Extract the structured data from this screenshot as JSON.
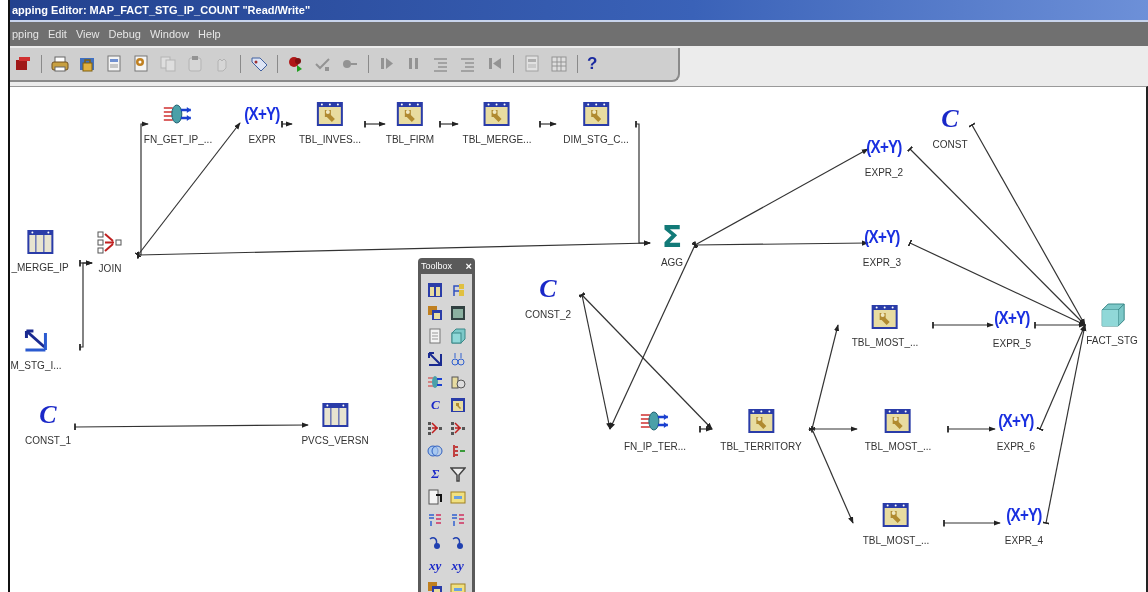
{
  "window": {
    "title": "apping Editor: MAP_FACT_STG_IP_COUNT \"Read/Write\""
  },
  "menu": [
    {
      "label": "pping"
    },
    {
      "label": "Edit"
    },
    {
      "label": "View"
    },
    {
      "label": "Debug"
    },
    {
      "label": "Window"
    },
    {
      "label": "Help"
    }
  ],
  "toolbar": [
    {
      "kind": "red-cube",
      "disabled": false
    },
    {
      "kind": "separator"
    },
    {
      "kind": "print",
      "disabled": false
    },
    {
      "kind": "lock",
      "disabled": false
    },
    {
      "kind": "document",
      "disabled": false
    },
    {
      "kind": "settings-doc",
      "disabled": false
    },
    {
      "kind": "copy",
      "disabled": true
    },
    {
      "kind": "paste",
      "disabled": true
    },
    {
      "kind": "undo",
      "disabled": true
    },
    {
      "kind": "separator"
    },
    {
      "kind": "tag",
      "disabled": false
    },
    {
      "kind": "separator"
    },
    {
      "kind": "deploy",
      "disabled": false
    },
    {
      "kind": "validate",
      "disabled": true
    },
    {
      "kind": "link",
      "disabled": true
    },
    {
      "kind": "separator"
    },
    {
      "kind": "play",
      "disabled": true
    },
    {
      "kind": "pause",
      "disabled": true
    },
    {
      "kind": "list",
      "disabled": true
    },
    {
      "kind": "list",
      "disabled": true
    },
    {
      "kind": "rewind",
      "disabled": true
    },
    {
      "kind": "separator"
    },
    {
      "kind": "document",
      "disabled": true
    },
    {
      "kind": "grid",
      "disabled": true
    },
    {
      "kind": "separator"
    },
    {
      "kind": "help",
      "label": "?"
    }
  ],
  "nodes": [
    {
      "kind": "table-grid",
      "label": "_MERGE_IP"
    },
    {
      "kind": "join",
      "label": "JOIN"
    },
    {
      "kind": "splitter",
      "label": "M_STG_I..."
    },
    {
      "kind": "function",
      "label": "FN_GET_IP_..."
    },
    {
      "kind": "expression",
      "symbol": "(X+Y)",
      "label": "EXPR"
    },
    {
      "kind": "table-key",
      "label": "TBL_INVES..."
    },
    {
      "kind": "table-key",
      "label": "TBL_FIRM"
    },
    {
      "kind": "table-key",
      "label": "TBL_MERGE..."
    },
    {
      "kind": "table-key",
      "label": "DIM_STG_C..."
    },
    {
      "kind": "aggregator",
      "symbol": "Σ",
      "label": "AGG"
    },
    {
      "kind": "expression",
      "symbol": "(X+Y)",
      "label": "EXPR_2"
    },
    {
      "kind": "constant",
      "symbol": "C",
      "label": "CONST"
    },
    {
      "kind": "expression",
      "symbol": "(X+Y)",
      "label": "EXPR_3"
    },
    {
      "kind": "constant",
      "symbol": "C",
      "label": "CONST_2"
    },
    {
      "kind": "function",
      "label": "FN_IP_TER..."
    },
    {
      "kind": "table-key",
      "label": "TBL_TERRITORY"
    },
    {
      "kind": "table-key",
      "label": "TBL_MOST_..."
    },
    {
      "kind": "expression",
      "symbol": "(X+Y)",
      "label": "EXPR_5"
    },
    {
      "kind": "cube",
      "label": "FACT_STG"
    },
    {
      "kind": "table-key",
      "label": "TBL_MOST_..."
    },
    {
      "kind": "expression",
      "symbol": "(X+Y)",
      "label": "EXPR_6"
    },
    {
      "kind": "table-key",
      "label": "TBL_MOST_..."
    },
    {
      "kind": "expression",
      "symbol": "(X+Y)",
      "label": "EXPR_4"
    },
    {
      "kind": "constant",
      "symbol": "C",
      "label": "CONST_1"
    },
    {
      "kind": "table-grid",
      "label": "PVCS_VERSN"
    }
  ],
  "toolbox": {
    "title": "Toolbox",
    "close": "×",
    "tools": [
      {
        "kind": "table-grid"
      },
      {
        "kind": "tree"
      },
      {
        "kind": "stacked"
      },
      {
        "kind": "dark-table"
      },
      {
        "kind": "document"
      },
      {
        "kind": "cube"
      },
      {
        "kind": "splitter"
      },
      {
        "kind": "sequence"
      },
      {
        "kind": "function"
      },
      {
        "kind": "cylinder"
      },
      {
        "kind": "symbol",
        "symbol": "C"
      },
      {
        "kind": "table-key"
      },
      {
        "kind": "join"
      },
      {
        "kind": "join"
      },
      {
        "kind": "circles"
      },
      {
        "kind": "dedup"
      },
      {
        "kind": "symbol",
        "symbol": "Σ"
      },
      {
        "kind": "funnel"
      },
      {
        "kind": "lookup"
      },
      {
        "kind": "note"
      },
      {
        "kind": "pivot"
      },
      {
        "kind": "pivot"
      },
      {
        "kind": "curve"
      },
      {
        "kind": "curve"
      },
      {
        "kind": "symbol",
        "symbol": "xy"
      },
      {
        "kind": "symbol",
        "symbol": "xy"
      },
      {
        "kind": "stacked"
      },
      {
        "kind": "note"
      }
    ]
  }
}
